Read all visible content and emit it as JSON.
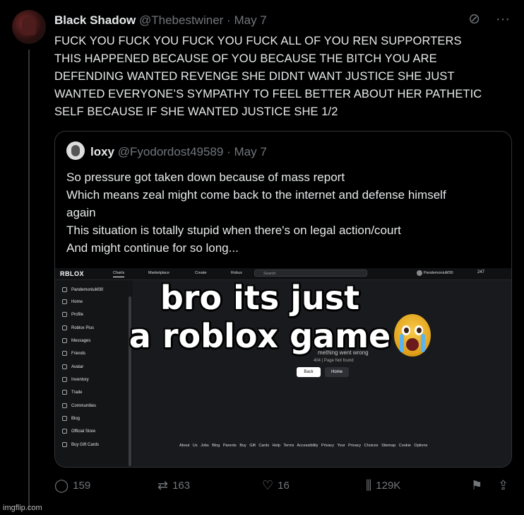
{
  "post": {
    "author_name": "Black Shadow",
    "author_handle": "@Thebestwiner",
    "separator": "·",
    "date": "May 7",
    "text_lines": [
      "FUCK YOU FUCK YOU FUCK YOU FUCK ALL OF YOU REN SUPPORTERS",
      "THIS HAPPENED BECAUSE OF YOU BECAUSE THE BITCH YOU ARE",
      "DEFENDING WANTED REVENGE SHE DIDNT WANT JUSTICE SHE JUST",
      "WANTED EVERYONE’S SYMPATHY TO FEEL BETTER ABOUT HER PATHETIC",
      "SELF BECAUSE IF SHE WANTED JUSTICE SHE 1/2"
    ],
    "top_icons": [
      "grok-icon",
      "more-icon"
    ]
  },
  "quote": {
    "author_name": "loxy",
    "author_handle": "@Fyodordost49589",
    "separator": "·",
    "date": "May 7",
    "text_lines": [
      "So pressure got taken down because of mass report",
      "Which means zeal might come back to the internet and defense himself",
      "again",
      "This situation is totally stupid when there's on legal action/court",
      "And might continue for so long..."
    ]
  },
  "media": {
    "overlay_line1": "bro its just",
    "overlay_line2": "a roblox game",
    "roblox": {
      "logo": "RBLOX",
      "nav": [
        "Charts",
        "Marketplace",
        "Create",
        "Robux"
      ],
      "search_placeholder": "Search",
      "username": "PandemoniuM30",
      "robux": "247",
      "sidebar_user": "PandemoniuM30",
      "sidebar": [
        "Home",
        "Profile",
        "Roblox Plus",
        "Messages",
        "Friends",
        "Avatar",
        "Inventory",
        "Trade",
        "Communities",
        "Blog",
        "Official Store",
        "Buy Gift Cards"
      ],
      "error_title": "mething went wrong",
      "error_sub": "404 | Page Not found",
      "back_button": "Back",
      "home_button": "Home",
      "footer": "About Us  Jobs  Blog  Parents  Buy Gift Cards  Help  Terms  Accessibility  Privacy  Your Privacy Choices  Sitemap  Cookie Options"
    }
  },
  "actions": {
    "replies": "159",
    "reposts": "163",
    "likes": "16",
    "views": "129K"
  },
  "watermark": "imgflip.com"
}
